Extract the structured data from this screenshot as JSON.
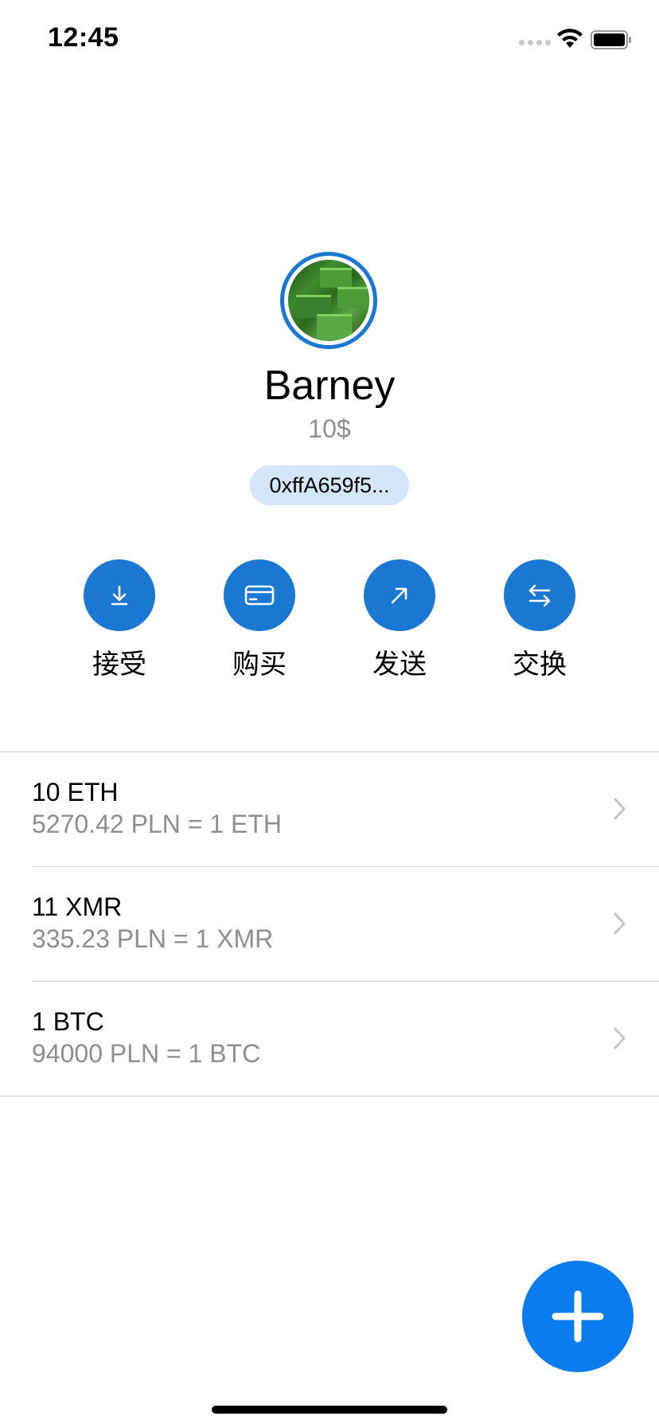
{
  "status_bar": {
    "time": "12:45"
  },
  "profile": {
    "name": "Barney",
    "balance": "10$",
    "address": "0xffA659f5..."
  },
  "actions": [
    {
      "label": "接受",
      "icon": "download-icon"
    },
    {
      "label": "购买",
      "icon": "card-icon"
    },
    {
      "label": "发送",
      "icon": "send-arrow-icon"
    },
    {
      "label": "交换",
      "icon": "swap-icon"
    }
  ],
  "tokens": [
    {
      "amount": "10 ETH",
      "rate": "5270.42 PLN = 1 ETH"
    },
    {
      "amount": "11 XMR",
      "rate": "335.23 PLN = 1 XMR"
    },
    {
      "amount": "1 BTC",
      "rate": "94000 PLN = 1 BTC"
    }
  ],
  "fab": {
    "icon": "plus-icon"
  },
  "colors": {
    "accent": "#1a78d2",
    "fab": "#0a7cf0",
    "pill": "#d4e6fb",
    "secondary_text": "#8e8e93"
  }
}
